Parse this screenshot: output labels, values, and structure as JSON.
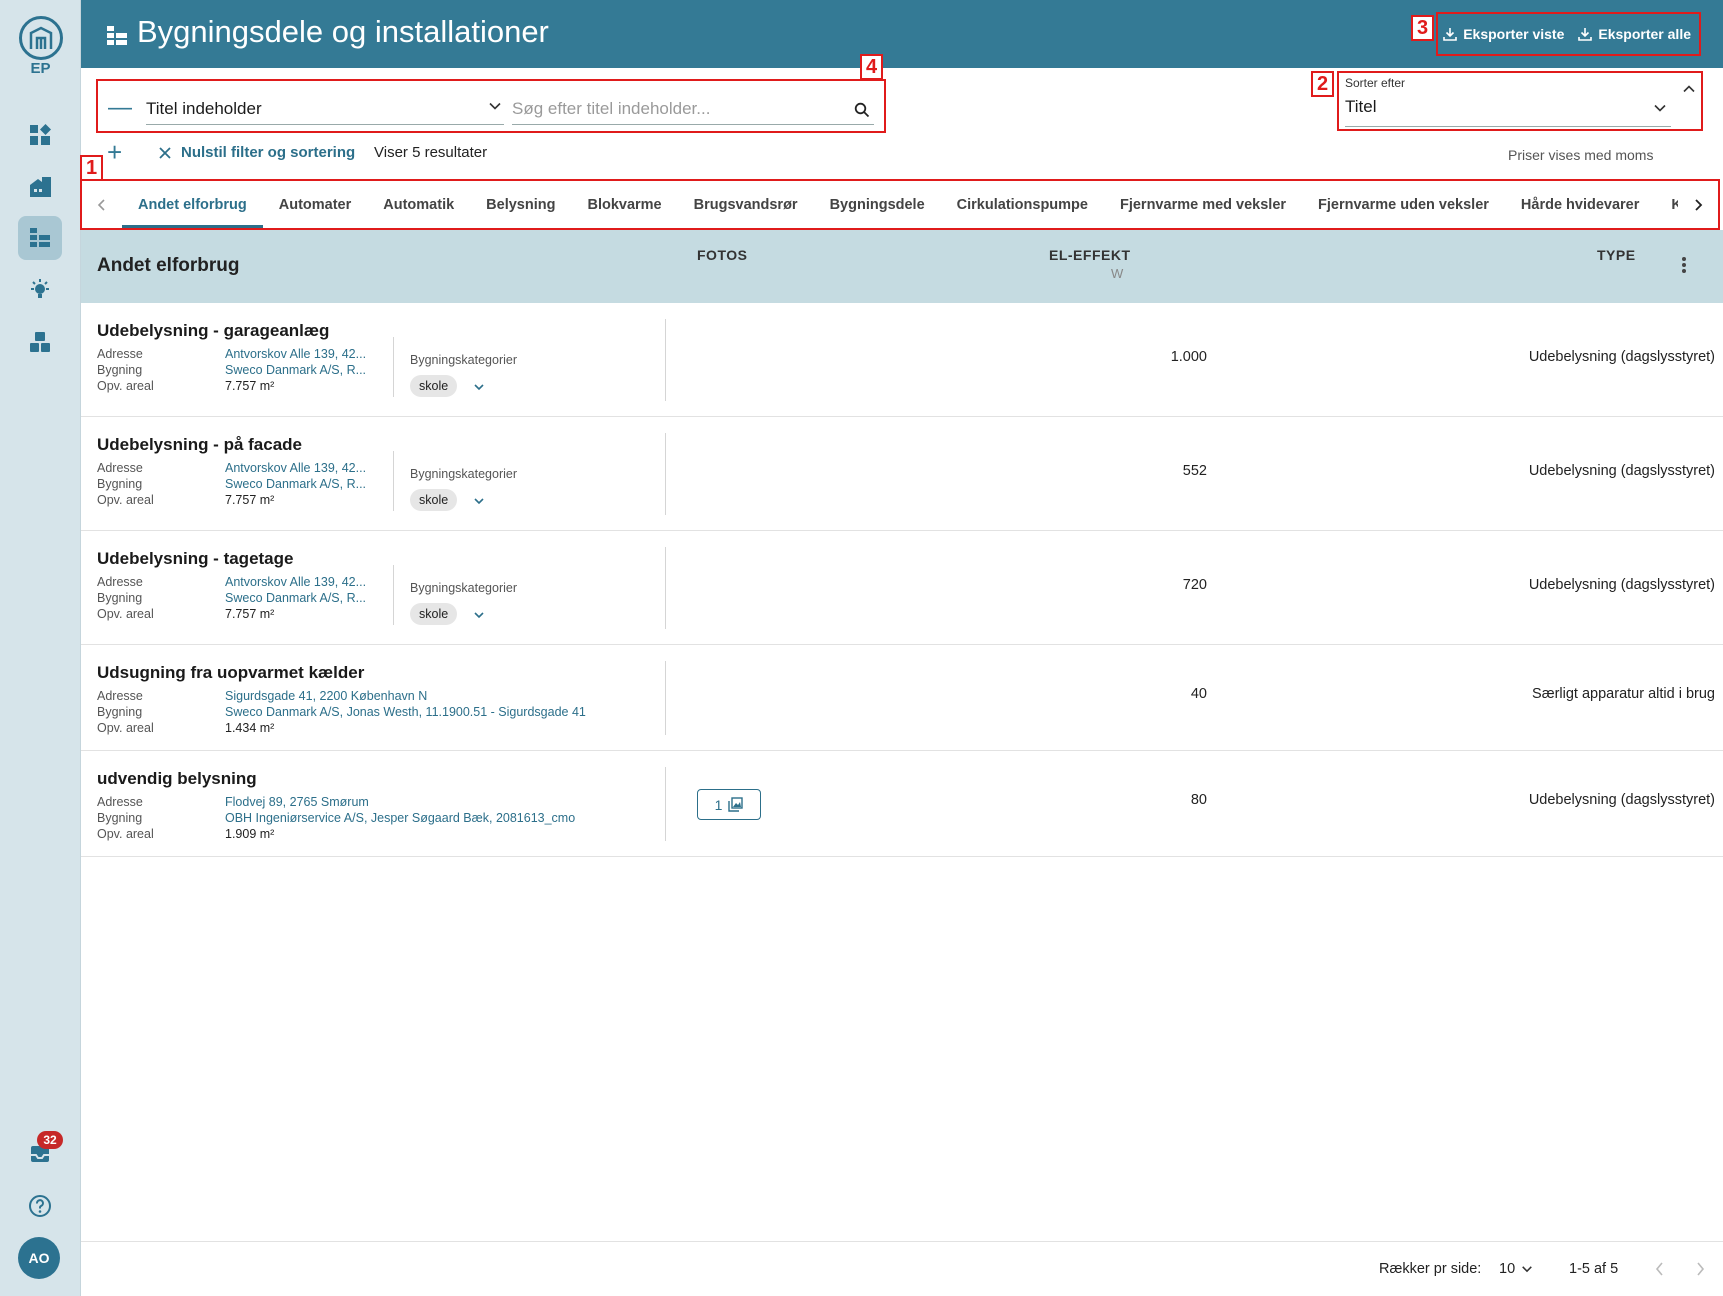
{
  "sidebar": {
    "logo_text": "EP",
    "notification_count": "32",
    "avatar_initials": "AO"
  },
  "header": {
    "title": "Bygningsdele og installationer",
    "export_shown": "Eksporter viste",
    "export_all": "Eksporter alle"
  },
  "annotations": {
    "tabs": "1",
    "sort": "2",
    "export": "3",
    "filter": "4"
  },
  "filter": {
    "field": "Titel indeholder",
    "search_placeholder": "Søg efter titel indeholder...",
    "reset": "Nulstil filter og sortering",
    "result_count": "Viser 5 resultater"
  },
  "sort": {
    "label": "Sorter efter",
    "value": "Titel"
  },
  "price_note": "Priser vises med moms",
  "tabs": [
    "Andet elforbrug",
    "Automater",
    "Automatik",
    "Belysning",
    "Blokvarme",
    "Brugsvandsrør",
    "Bygningsdele",
    "Cirkulationspumpe",
    "Fjernvarme med veksler",
    "Fjernvarme uden veksler",
    "Hårde hvidevarer",
    "Kedel"
  ],
  "active_tab": "Andet elforbrug",
  "table": {
    "group_title": "Andet elforbrug",
    "col_photos": "FOTOS",
    "col_power": "EL-EFFEKT",
    "col_power_unit": "W",
    "col_type": "TYPE",
    "meta_labels": {
      "address": "Adresse",
      "building": "Bygning",
      "area": "Opv. areal"
    },
    "category_label": "Bygningskategorier",
    "rows": [
      {
        "title": "Udebelysning - garageanlæg",
        "address": "Antvorskov Alle 139, 42...",
        "building": "Sweco Danmark A/S, R...",
        "area": "7.757 m²",
        "category": "skole",
        "power": "1.000",
        "type": "Udebelysning (dagslysstyret)"
      },
      {
        "title": "Udebelysning - på facade",
        "address": "Antvorskov Alle 139, 42...",
        "building": "Sweco Danmark A/S, R...",
        "area": "7.757 m²",
        "category": "skole",
        "power": "552",
        "type": "Udebelysning (dagslysstyret)"
      },
      {
        "title": "Udebelysning - tagetage",
        "address": "Antvorskov Alle 139, 42...",
        "building": "Sweco Danmark A/S, R...",
        "area": "7.757 m²",
        "category": "skole",
        "power": "720",
        "type": "Udebelysning (dagslysstyret)"
      },
      {
        "title": "Udsugning fra uopvarmet kælder",
        "address": "Sigurdsgade 41, 2200 København N",
        "building": "Sweco Danmark A/S, Jonas Westh, 11.1900.51 - Sigurdsgade 41",
        "area": "1.434 m²",
        "power": "40",
        "type": "Særligt apparatur altid i brug"
      },
      {
        "title": "udvendig belysning",
        "address": "Flodvej 89, 2765 Smørum",
        "building": "OBH Ingeniørservice A/S, Jesper Søgaard Bæk, 2081613_cmo",
        "area": "1.909 m²",
        "photo_count": "1",
        "power": "80",
        "type": "Udebelysning (dagslysstyret)"
      }
    ]
  },
  "pagination": {
    "rows_label": "Rækker pr side:",
    "rows_value": "10",
    "range": "1-5 af 5"
  },
  "colors": {
    "brand": "#347a95",
    "accent": "#2c6f8a",
    "highlight": "#e01b1b",
    "sidebar": "#d6e4ea"
  }
}
